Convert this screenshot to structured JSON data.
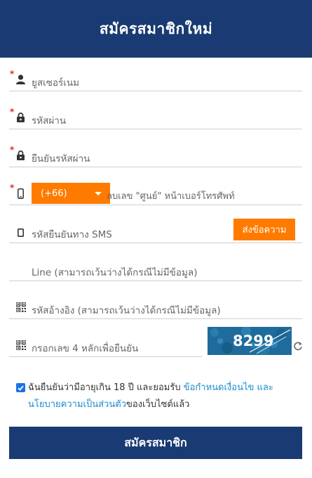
{
  "header": {
    "title": "สมัครสมาชิกใหม่"
  },
  "form": {
    "required_mark": "*",
    "username": {
      "placeholder": "ยูสเซอร์เนม",
      "icon": "user-icon"
    },
    "password": {
      "placeholder": "รหัสผ่าน",
      "icon": "lock-icon"
    },
    "confirm_password": {
      "placeholder": "ยืนยันรหัสผ่าน",
      "icon": "lock-icon"
    },
    "phone": {
      "country_code": "(+66)",
      "placeholder": "ลบเลข \"ศูนย์\" หน้าเบอร์โทรศัพท์",
      "icon": "mobile-phone-icon"
    },
    "sms": {
      "placeholder": "รหัสยืนยันทาง SMS",
      "button_label": "ส่งข้อความ",
      "icon": "tablet-icon"
    },
    "line": {
      "placeholder": "Line (สามารถเว้นว่างได้กรณีไม่มีข้อมูล)"
    },
    "referral": {
      "placeholder": "รหัสอ้างอิง (สามารถเว้นว่างได้กรณีไม่มีข้อมูล)",
      "icon": "qr-code-icon"
    },
    "captcha": {
      "placeholder": "กรอกเลข 4 หลักเพื่อยืนยัน",
      "code": "8299",
      "icon": "qr-code-icon"
    },
    "agreement": {
      "checked": true,
      "text_before": "ฉันยืนยันว่ามีอายุเกิน 18 ปี และยอมรับ ",
      "terms_link": "ข้อกำหนดเงื่อนไข",
      "and": " และ",
      "privacy_link": "นโยบายความเป็นส่วนตัว",
      "text_after": "ของเว็บไซต์แล้ว"
    },
    "submit_label": "สมัครสมาชิก"
  },
  "colors": {
    "header": "#193a72",
    "accent": "#ff7b00",
    "link": "#1a8bd0",
    "required": "#e3262d"
  }
}
